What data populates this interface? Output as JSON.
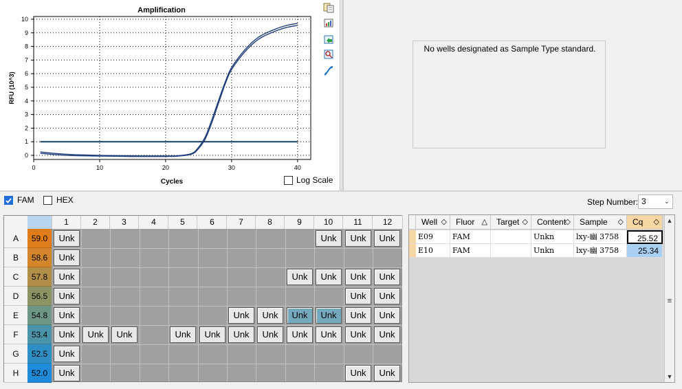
{
  "chart": {
    "chart_data": {
      "type": "line",
      "title": "Amplification",
      "xlabel": "Cycles",
      "ylabel": "RFU (10^3)",
      "xlim": [
        0,
        42
      ],
      "ylim": [
        -0.3,
        10.2
      ],
      "x_ticks": [
        0,
        10,
        20,
        30,
        40
      ],
      "y_ticks": [
        0,
        1,
        2,
        3,
        4,
        5,
        6,
        7,
        8,
        9,
        10
      ],
      "grid": true,
      "threshold": 1.0,
      "series": [
        {
          "points": [
            [
              1,
              0.15
            ],
            [
              5,
              0.0
            ],
            [
              10,
              -0.05
            ],
            [
              15,
              -0.08
            ],
            [
              20,
              -0.08
            ],
            [
              22,
              -0.05
            ],
            [
              24,
              0.1
            ],
            [
              25,
              0.5
            ],
            [
              26,
              1.2
            ],
            [
              27,
              2.4
            ],
            [
              28,
              3.8
            ],
            [
              29,
              5.2
            ],
            [
              30,
              6.3
            ],
            [
              32,
              7.6
            ],
            [
              34,
              8.5
            ],
            [
              36,
              9.0
            ],
            [
              38,
              9.35
            ],
            [
              40,
              9.55
            ]
          ]
        },
        {
          "points": [
            [
              1,
              0.25
            ],
            [
              5,
              0.08
            ],
            [
              10,
              0.0
            ],
            [
              15,
              -0.03
            ],
            [
              20,
              -0.04
            ],
            [
              22,
              -0.02
            ],
            [
              24,
              0.15
            ],
            [
              25,
              0.6
            ],
            [
              26,
              1.35
            ],
            [
              27,
              2.6
            ],
            [
              28,
              4.0
            ],
            [
              29,
              5.35
            ],
            [
              30,
              6.45
            ],
            [
              32,
              7.75
            ],
            [
              34,
              8.65
            ],
            [
              36,
              9.15
            ],
            [
              38,
              9.5
            ],
            [
              40,
              9.7
            ]
          ]
        }
      ]
    },
    "log_scale_label": "Log Scale",
    "colors": {
      "series": "#1f3d7a",
      "threshold": "#0f3d66",
      "grid": "#000000"
    }
  },
  "toolbar_icons": [
    "copy-icon",
    "chart-settings-icon",
    "export-icon",
    "zoom-icon",
    "curve-icon"
  ],
  "standard_curve": {
    "message": "No wells designated as Sample Type standard."
  },
  "fluors": [
    {
      "label": "FAM",
      "checked": true
    },
    {
      "label": "HEX",
      "checked": false
    }
  ],
  "step": {
    "label": "Step Number:",
    "value": "3"
  },
  "plate": {
    "columns": [
      "1",
      "2",
      "3",
      "4",
      "5",
      "6",
      "7",
      "8",
      "9",
      "10",
      "11",
      "12"
    ],
    "rows": [
      {
        "label": "A",
        "temp": "59.0",
        "color": "#e07c1a"
      },
      {
        "label": "B",
        "temp": "58.6",
        "color": "#d2852a"
      },
      {
        "label": "C",
        "temp": "57.8",
        "color": "#b08e48"
      },
      {
        "label": "D",
        "temp": "56.5",
        "color": "#8c9464"
      },
      {
        "label": "E",
        "temp": "54.8",
        "color": "#6d9784"
      },
      {
        "label": "F",
        "temp": "53.4",
        "color": "#4a93a8"
      },
      {
        "label": "G",
        "temp": "52.5",
        "color": "#2e8fc4"
      },
      {
        "label": "H",
        "temp": "52.0",
        "color": "#1f8ad8"
      }
    ],
    "wells": [
      {
        "row": 0,
        "col": 0,
        "label": "Unk"
      },
      {
        "row": 0,
        "col": 9,
        "label": "Unk"
      },
      {
        "row": 0,
        "col": 10,
        "label": "Unk"
      },
      {
        "row": 0,
        "col": 11,
        "label": "Unk"
      },
      {
        "row": 1,
        "col": 0,
        "label": "Unk"
      },
      {
        "row": 2,
        "col": 0,
        "label": "Unk"
      },
      {
        "row": 2,
        "col": 8,
        "label": "Unk"
      },
      {
        "row": 2,
        "col": 9,
        "label": "Unk"
      },
      {
        "row": 2,
        "col": 10,
        "label": "Unk"
      },
      {
        "row": 2,
        "col": 11,
        "label": "Unk"
      },
      {
        "row": 3,
        "col": 0,
        "label": "Unk"
      },
      {
        "row": 3,
        "col": 10,
        "label": "Unk"
      },
      {
        "row": 3,
        "col": 11,
        "label": "Unk"
      },
      {
        "row": 4,
        "col": 0,
        "label": "Unk"
      },
      {
        "row": 4,
        "col": 6,
        "label": "Unk"
      },
      {
        "row": 4,
        "col": 7,
        "label": "Unk"
      },
      {
        "row": 4,
        "col": 8,
        "label": "Unk",
        "selected": true
      },
      {
        "row": 4,
        "col": 9,
        "label": "Unk",
        "selected": true
      },
      {
        "row": 4,
        "col": 10,
        "label": "Unk"
      },
      {
        "row": 4,
        "col": 11,
        "label": "Unk"
      },
      {
        "row": 5,
        "col": 0,
        "label": "Unk"
      },
      {
        "row": 5,
        "col": 1,
        "label": "Unk"
      },
      {
        "row": 5,
        "col": 2,
        "label": "Unk"
      },
      {
        "row": 5,
        "col": 4,
        "label": "Unk"
      },
      {
        "row": 5,
        "col": 5,
        "label": "Unk"
      },
      {
        "row": 5,
        "col": 6,
        "label": "Unk"
      },
      {
        "row": 5,
        "col": 7,
        "label": "Unk"
      },
      {
        "row": 5,
        "col": 8,
        "label": "Unk"
      },
      {
        "row": 5,
        "col": 9,
        "label": "Unk"
      },
      {
        "row": 5,
        "col": 10,
        "label": "Unk"
      },
      {
        "row": 5,
        "col": 11,
        "label": "Unk"
      },
      {
        "row": 6,
        "col": 0,
        "label": "Unk"
      },
      {
        "row": 7,
        "col": 0,
        "label": "Unk"
      },
      {
        "row": 7,
        "col": 10,
        "label": "Unk"
      },
      {
        "row": 7,
        "col": 11,
        "label": "Unk"
      }
    ]
  },
  "results_table": {
    "columns": [
      {
        "label": "Well",
        "sort": "◇"
      },
      {
        "label": "Fluor",
        "sort": "△"
      },
      {
        "label": "Target",
        "sort": "◇"
      },
      {
        "label": "Content",
        "sort": "◇"
      },
      {
        "label": "Sample",
        "sort": "◇"
      },
      {
        "label": "Cq",
        "sort": "◇"
      }
    ],
    "rows": [
      {
        "well": "E09",
        "fluor": "FAM",
        "target": "",
        "content": "Unkn",
        "sample": "lxy-幽 3758",
        "cq": "25.52"
      },
      {
        "well": "E10",
        "fluor": "FAM",
        "target": "",
        "content": "Unkn",
        "sample": "lxy-幽 3758",
        "cq": "25.34"
      }
    ]
  }
}
